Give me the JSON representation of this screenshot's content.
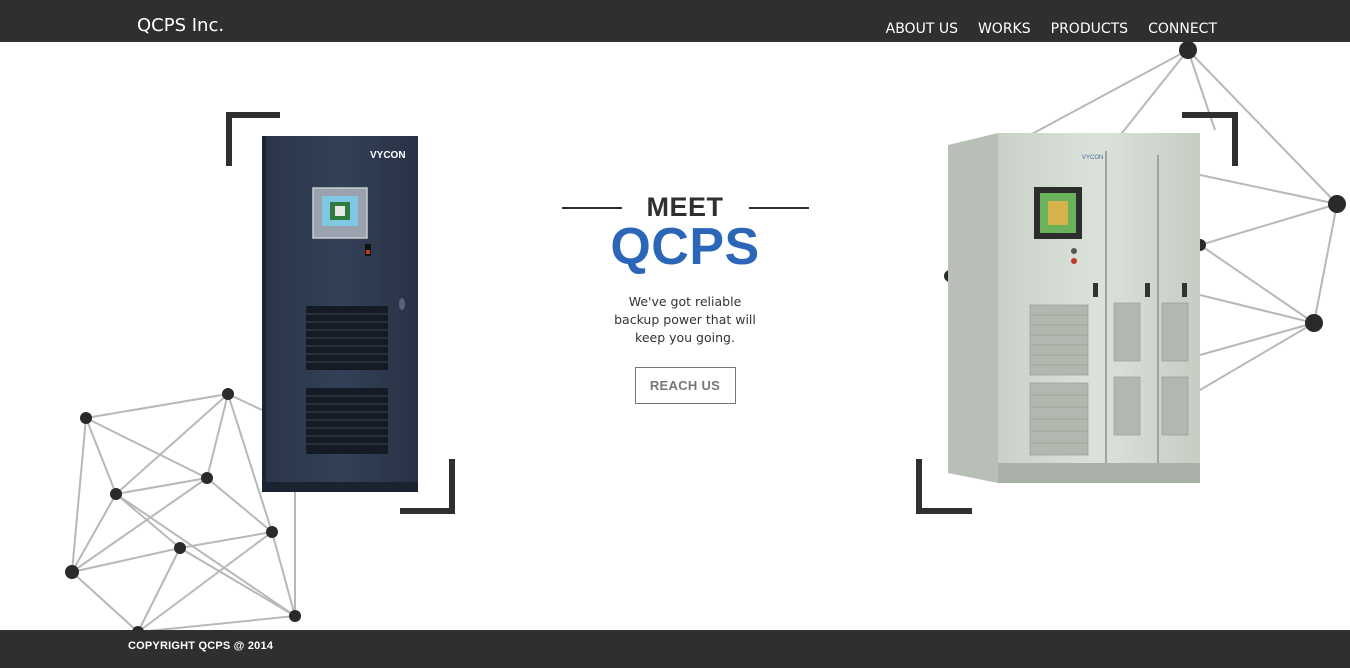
{
  "header": {
    "brand": "QCPS Inc.",
    "nav": [
      "ABOUT US",
      "WORKS",
      "PRODUCTS",
      "CONNECT"
    ]
  },
  "hero": {
    "eyebrow": "MEET",
    "title": "QCPS",
    "tagline": "We've got reliable backup power that will keep you going.",
    "cta_label": "REACH US"
  },
  "products": {
    "left_brand": "VYCON",
    "right_brand": "VYCON"
  },
  "footer": {
    "copyright": "COPYRIGHT QCPS @ 2014"
  },
  "colors": {
    "bar": "#2f2f2f",
    "accent_blue": "#2c66b8",
    "network_line": "#b8b8b8",
    "node": "#2a2a2a"
  },
  "icons": [
    "network-graphic-left",
    "network-graphic-right",
    "corner-bracket"
  ]
}
